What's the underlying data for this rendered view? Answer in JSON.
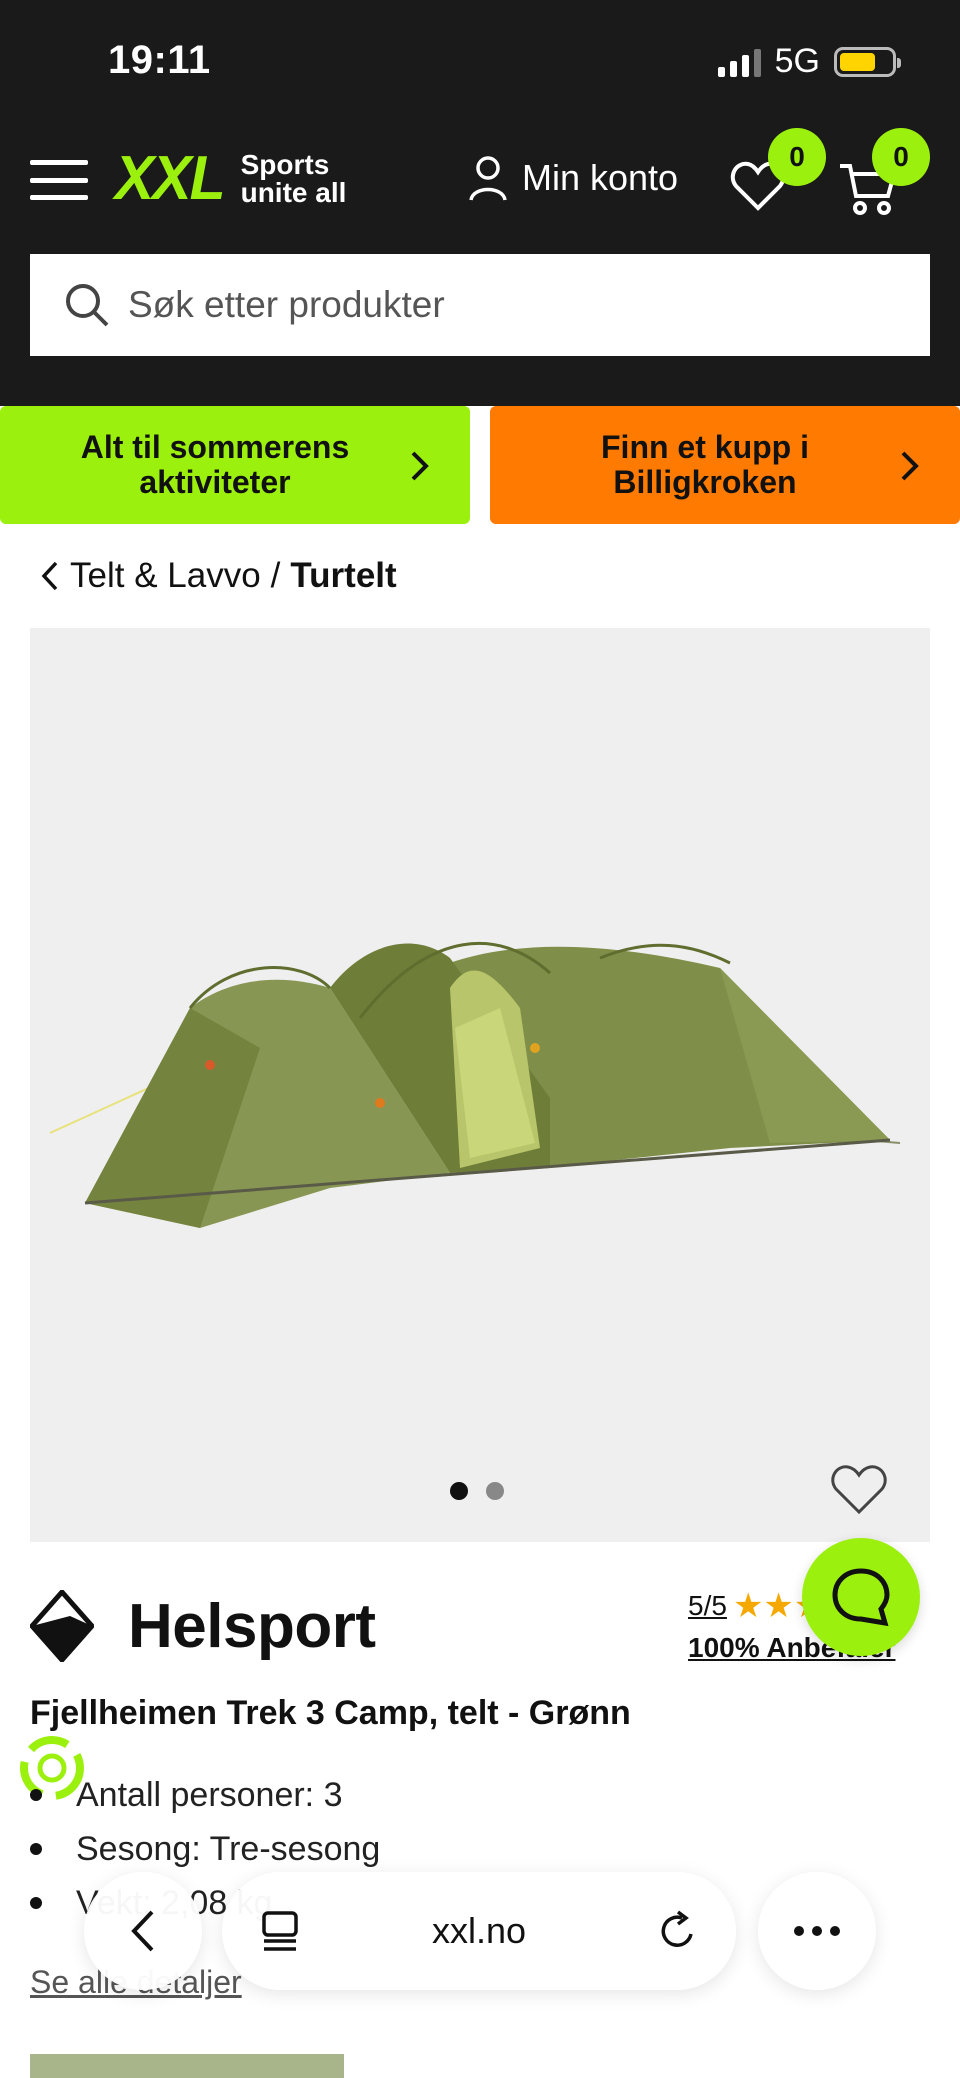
{
  "status": {
    "time": "19:11",
    "network": "5G"
  },
  "header": {
    "logo_text": "XXL",
    "logo_tagline_1": "Sports",
    "logo_tagline_2": "unite all",
    "account_label": "Min konto",
    "wishlist_count": "0",
    "cart_count": "0"
  },
  "search": {
    "placeholder": "Søk etter produkter"
  },
  "promos": {
    "green_line_1": "Alt til sommerens",
    "green_line_2": "aktiviteter",
    "orange_line_1": "Finn et kupp i",
    "orange_line_2": "Billigkroken"
  },
  "breadcrumb": {
    "parent": "Telt & Lavvo",
    "separator": "/",
    "current": "Turtelt"
  },
  "product": {
    "brand": "Helsport",
    "rating_score": "5/5",
    "stars": "★★★★★",
    "recommend": "100% Anbefaler",
    "title": "Fjellheimen Trek 3 Camp, telt - Grønn",
    "specs": [
      "Antall personer: 3",
      "Sesong: Tre-sesong",
      "Vekt: 2,08 kg"
    ],
    "see_details": "Se alle detaljer",
    "image_count": 2,
    "active_image": 1
  },
  "browser": {
    "url": "xxl.no"
  },
  "colors": {
    "accent": "#9cf00e",
    "orange": "#ff7a00",
    "header_bg": "#1a1a1a"
  },
  "icons": [
    "menu-icon",
    "user-icon",
    "heart-icon",
    "cart-icon",
    "search-icon",
    "chevron-right-icon",
    "chevron-left-icon",
    "chat-icon",
    "leaf-badge-icon",
    "tabs-icon",
    "reload-icon",
    "more-icon"
  ]
}
